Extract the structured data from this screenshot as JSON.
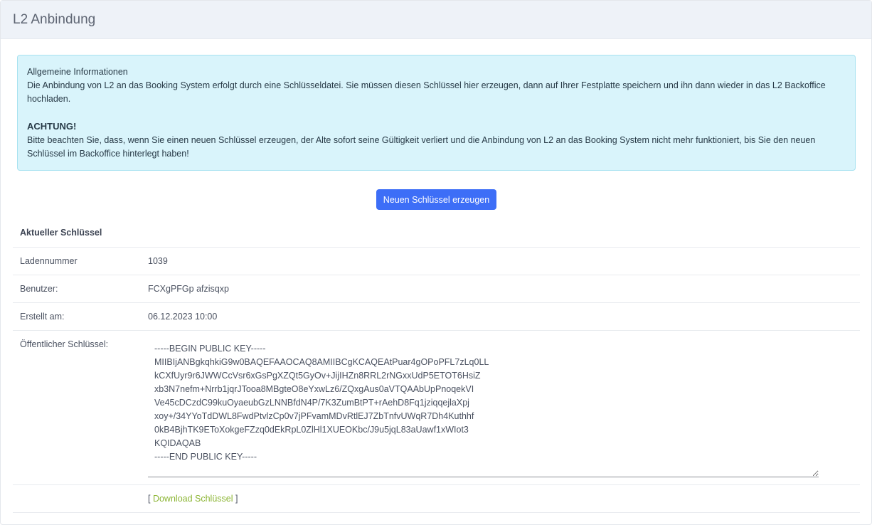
{
  "header": {
    "title": "L2 Anbindung"
  },
  "alert": {
    "heading": "Allgemeine Informationen",
    "text": "Die Anbindung von L2 an das Booking System erfolgt durch eine Schlüsseldatei. Sie müssen diesen Schlüssel hier erzeugen, dann auf Ihrer Festplatte speichern und ihn dann wieder in das L2 Backoffice hochladen.",
    "warning_title": "ACHTUNG!",
    "warning_text": "Bitte beachten Sie, dass, wenn Sie einen neuen Schlüssel erzeugen, der Alte sofort seine Gültigkeit verliert und die Anbindung von L2 an das Booking System nicht mehr funktioniert, bis Sie den neuen Schlüssel im Backoffice hinterlegt haben!"
  },
  "actions": {
    "generate_label": "Neuen Schlüssel erzeugen"
  },
  "current_key": {
    "section_title": "Aktueller Schlüssel",
    "store_label": "Ladennummer",
    "store_value": "1039",
    "user_label": "Benutzer:",
    "user_value": "FCXgPFGp afzisqxp",
    "created_label": "Erstellt am:",
    "created_value": "06.12.2023 10:00",
    "public_key_label": "Öffentlicher Schlüssel:",
    "public_key_value": "-----BEGIN PUBLIC KEY-----\nMIIBIjANBgkqhkiG9w0BAQEFAAOCAQ8AMIIBCgKCAQEAtPuar4gOPoPFL7zLq0LL\nkCXfUyr9r6JWWCcVsr6xGsPgXZQt5GyOv+JijIHZn8RRL2rNGxxUdP5ETOT6HsiZ\nxb3N7nefm+Nrrb1jqrJTooa8MBgteO8eYxwLz6/ZQxgAus0aVTQAAbUpPnoqekVI\nVe45cDCzdC99kuOyaeubGzLNNBfdN4P/7K3ZumBtPT+rAehD8Fq1jziqqejlaXpj\nxoy+/34YYoTdDWL8FwdPtvlzCp0v7jPFvamMDvRtlEJ7ZbTnfvUWqR7Dh4Kuthhf\n0kB4BjhTK9EToXokgeFZzq0dEkRpL0ZlHl1XUEOKbc/J9u5jqL83aUawf1xWIot3\nKQIDAQAB\n-----END PUBLIC KEY-----",
    "download_open": "[ ",
    "download_label": "Download Schlüssel",
    "download_close": " ]"
  }
}
